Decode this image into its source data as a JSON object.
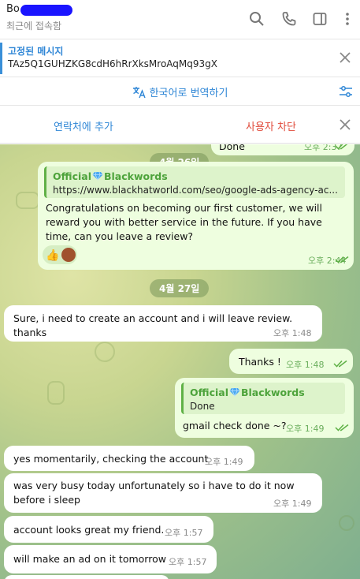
{
  "header": {
    "contact_name": "Bo",
    "last_seen": "최근에 접속함",
    "icons": [
      "search-icon",
      "phone-icon",
      "sidebar-icon",
      "more-icon"
    ]
  },
  "pinned": {
    "title": "고정된 메시지",
    "text": "TAz5Q1GUHZKG8cdH6hRrXksMroAqMq93gX"
  },
  "translate": {
    "label": "한국어로 번역하기"
  },
  "actions": {
    "add_contact": "연락처에 추가",
    "block_user": "사용자 차단"
  },
  "messages": {
    "m0": {
      "text": "Done",
      "time": "오후 2:37"
    },
    "date1": "4월 26일",
    "m1": {
      "quote_name": "Official",
      "quote_name2": "Blackwords",
      "quote_text": "https://www.blackhatworld.com/seo/google-ads-agency-ac...",
      "text": "Congratulations on becoming our first customer, we will reward you with better service in the future. If you have time, can you leave a review?",
      "time": "오후 2:44"
    },
    "date2": "4월 27일",
    "m2": {
      "text": "Sure, i need to create an account and i will leave review. thanks",
      "time": "오후 1:48"
    },
    "m3": {
      "text": "Thanks !",
      "time": "오후 1:48"
    },
    "m4": {
      "quote_name": "Official",
      "quote_name2": "Blackwords",
      "quote_text": "Done",
      "text": "gmail check done ~?",
      "time": "오후 1:49"
    },
    "m5": {
      "text": "yes momentarily, checking the account",
      "time": "오후 1:49"
    },
    "m6": {
      "text": "was very busy today unfortunately so i have to do it now before i sleep",
      "time": "오후 1:49"
    },
    "m7": {
      "text": "account looks great my friend.",
      "time": "오후 1:57"
    },
    "m8": {
      "text": "will make an ad on it tomorrow",
      "time": "오후 1:57"
    }
  },
  "colors": {
    "accent": "#2e86d6",
    "danger": "#e04a3a",
    "outgoing": "#eefedf",
    "quote": "#4da33b"
  }
}
